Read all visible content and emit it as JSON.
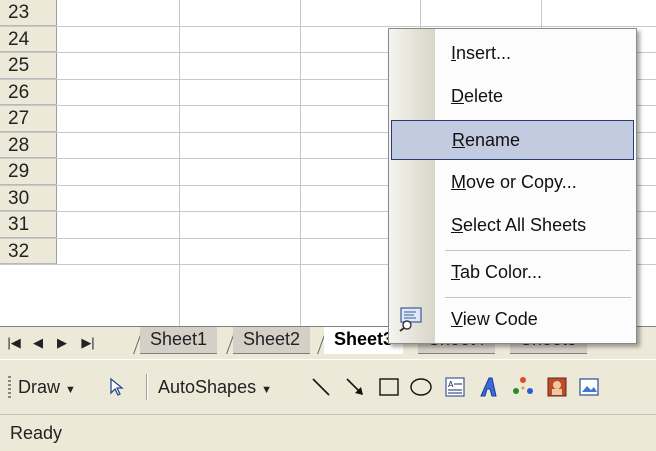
{
  "grid": {
    "rows": [
      "23",
      "24",
      "25",
      "26",
      "27",
      "28",
      "29",
      "30",
      "31",
      "32"
    ]
  },
  "sheet_tabs": {
    "nav": [
      "|◀",
      "◀",
      "▶",
      "▶|"
    ],
    "tabs": [
      {
        "label": "Sheet1",
        "active": false
      },
      {
        "label": "Sheet2",
        "active": false
      },
      {
        "label": "Sheet3",
        "active": true
      },
      {
        "label": "Sheet4",
        "active": false
      },
      {
        "label": "Sheet5",
        "active": false
      }
    ]
  },
  "toolbar": {
    "draw_label": "Draw",
    "autoshapes_label": "AutoShapes",
    "icons": [
      "select-objects-icon",
      "line-icon",
      "arrow-icon",
      "rectangle-icon",
      "oval-icon",
      "text-box-icon",
      "wordart-icon",
      "diagram-icon",
      "clip-art-icon",
      "picture-icon"
    ]
  },
  "status": {
    "text": "Ready"
  },
  "context_menu": {
    "items": [
      {
        "label": "Insert...",
        "accel": "I"
      },
      {
        "label": "Delete",
        "accel": "D"
      },
      {
        "label": "Rename",
        "accel": "R",
        "highlighted": true
      },
      {
        "label": "Move or Copy...",
        "accel": "M"
      },
      {
        "label": "Select All Sheets",
        "accel": "S"
      },
      {
        "label": "Tab Color...",
        "accel": "T"
      },
      {
        "label": "View Code",
        "accel": "V",
        "icon": "view-code-icon"
      }
    ]
  },
  "colors": {
    "chrome": "#ece9d8",
    "menu_highlight": "#c2cbe0",
    "menu_highlight_border": "#2a3e7a",
    "gridline": "#c8c8c8"
  }
}
